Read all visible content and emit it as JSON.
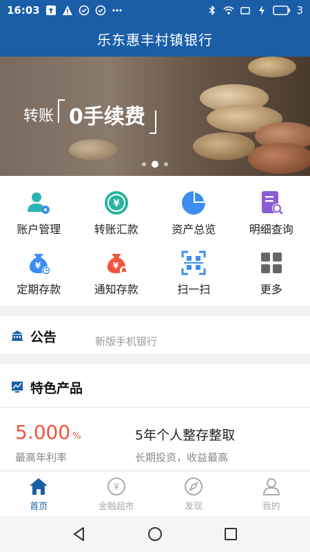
{
  "status_bar": {
    "time": "16:03",
    "battery": "3"
  },
  "app": {
    "title": "乐东惠丰村镇银行"
  },
  "banner": {
    "text_prefix": "转账",
    "text_highlight": "0手续费",
    "slide_count": 3,
    "active_slide": 2
  },
  "menu": [
    {
      "label": "账户管理",
      "icon": "account-manage-icon",
      "color": "#2ab3b3"
    },
    {
      "label": "转账汇款",
      "icon": "transfer-icon",
      "color": "#2ab3a0"
    },
    {
      "label": "资产总览",
      "icon": "pie-chart-icon",
      "color": "#3d8ef0"
    },
    {
      "label": "明细查询",
      "icon": "detail-search-icon",
      "color": "#8a5cd6"
    },
    {
      "label": "定期存款",
      "icon": "fixed-deposit-icon",
      "color": "#3d8ef0"
    },
    {
      "label": "通知存款",
      "icon": "notice-deposit-icon",
      "color": "#f0553f"
    },
    {
      "label": "扫一扫",
      "icon": "scan-icon",
      "color": "#3d8ef0"
    },
    {
      "label": "更多",
      "icon": "more-grid-icon",
      "color": "#666666"
    }
  ],
  "notice": {
    "title": "公告",
    "text": "新版手机银行"
  },
  "products": {
    "title": "特色产品",
    "rate": "5.000",
    "rate_unit": "%",
    "rate_label": "最高年利率",
    "name": "5年个人整存整取",
    "desc": "长期投资，收益最高"
  },
  "tabs": [
    {
      "label": "首页",
      "icon": "home-icon",
      "active": true
    },
    {
      "label": "金融超市",
      "icon": "yuan-circle-icon",
      "active": false
    },
    {
      "label": "发现",
      "icon": "compass-icon",
      "active": false
    },
    {
      "label": "我的",
      "icon": "user-icon",
      "active": false
    }
  ],
  "colors": {
    "primary": "#1a5ea8",
    "accent_red": "#f0553f"
  }
}
